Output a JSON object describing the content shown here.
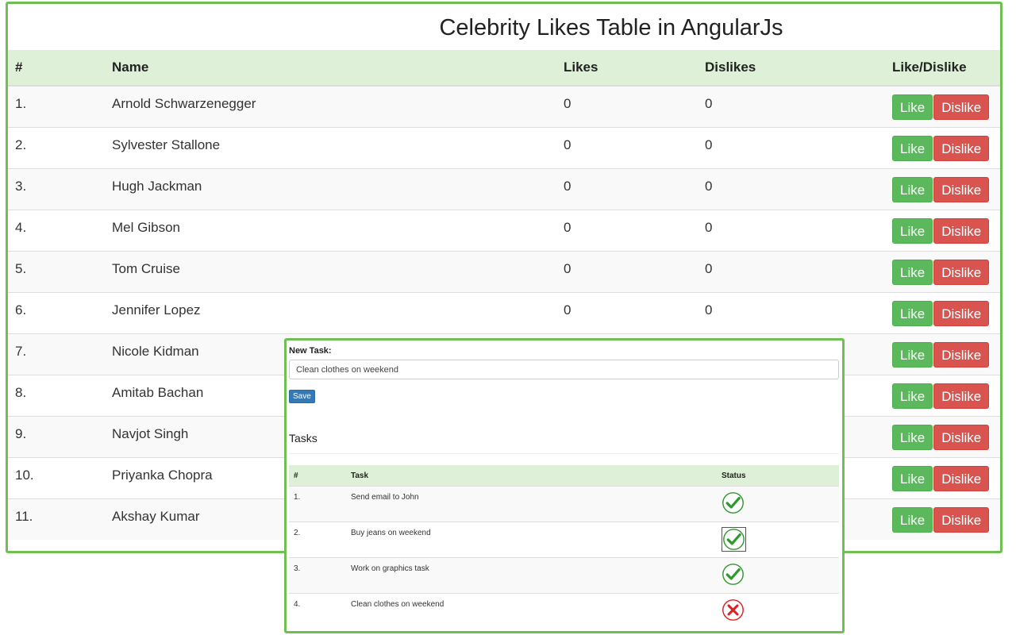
{
  "celebrities": {
    "title": "Celebrity Likes Table in AngularJs",
    "headers": {
      "num": "#",
      "name": "Name",
      "likes": "Likes",
      "dislikes": "Dislikes",
      "action": "Like/Dislike"
    },
    "like_label": "Like",
    "dislike_label": "Dislike",
    "rows": [
      {
        "num": "1.",
        "name": "Arnold Schwarzenegger",
        "likes": "0",
        "dislikes": "0"
      },
      {
        "num": "2.",
        "name": "Sylvester Stallone",
        "likes": "0",
        "dislikes": "0"
      },
      {
        "num": "3.",
        "name": "Hugh Jackman",
        "likes": "0",
        "dislikes": "0"
      },
      {
        "num": "4.",
        "name": "Mel Gibson",
        "likes": "0",
        "dislikes": "0"
      },
      {
        "num": "5.",
        "name": "Tom Cruise",
        "likes": "0",
        "dislikes": "0"
      },
      {
        "num": "6.",
        "name": "Jennifer Lopez",
        "likes": "0",
        "dislikes": "0"
      },
      {
        "num": "7.",
        "name": "Nicole Kidman",
        "likes": "",
        "dislikes": ""
      },
      {
        "num": "8.",
        "name": "Amitab Bachan",
        "likes": "",
        "dislikes": ""
      },
      {
        "num": "9.",
        "name": "Navjot Singh",
        "likes": "",
        "dislikes": ""
      },
      {
        "num": "10.",
        "name": "Priyanka Chopra",
        "likes": "",
        "dislikes": ""
      },
      {
        "num": "11.",
        "name": "Akshay Kumar",
        "likes": "",
        "dislikes": ""
      }
    ]
  },
  "tasks": {
    "new_task_label": "New Task:",
    "input_value": "Clean clothes on weekend",
    "save_label": "Save",
    "heading": "Tasks",
    "headers": {
      "num": "#",
      "task": "Task",
      "status": "Status"
    },
    "rows": [
      {
        "num": "1.",
        "task": "Send email to John",
        "status_icon": "check-icon"
      },
      {
        "num": "2.",
        "task": "Buy jeans on weekend",
        "status_icon": "check-icon"
      },
      {
        "num": "3.",
        "task": "Work on graphics task",
        "status_icon": "check-icon"
      },
      {
        "num": "4.",
        "task": "Clean clothes on weekend",
        "status_icon": "cross-icon"
      }
    ]
  },
  "colors": {
    "panel_border": "#6fbf55",
    "header_bg": "#dff0d8",
    "like_green": "#5cb85c",
    "dislike_red": "#d9534f",
    "save_blue": "#337ab7",
    "check_green": "#2e9a2e",
    "cross_red": "#e02020"
  }
}
